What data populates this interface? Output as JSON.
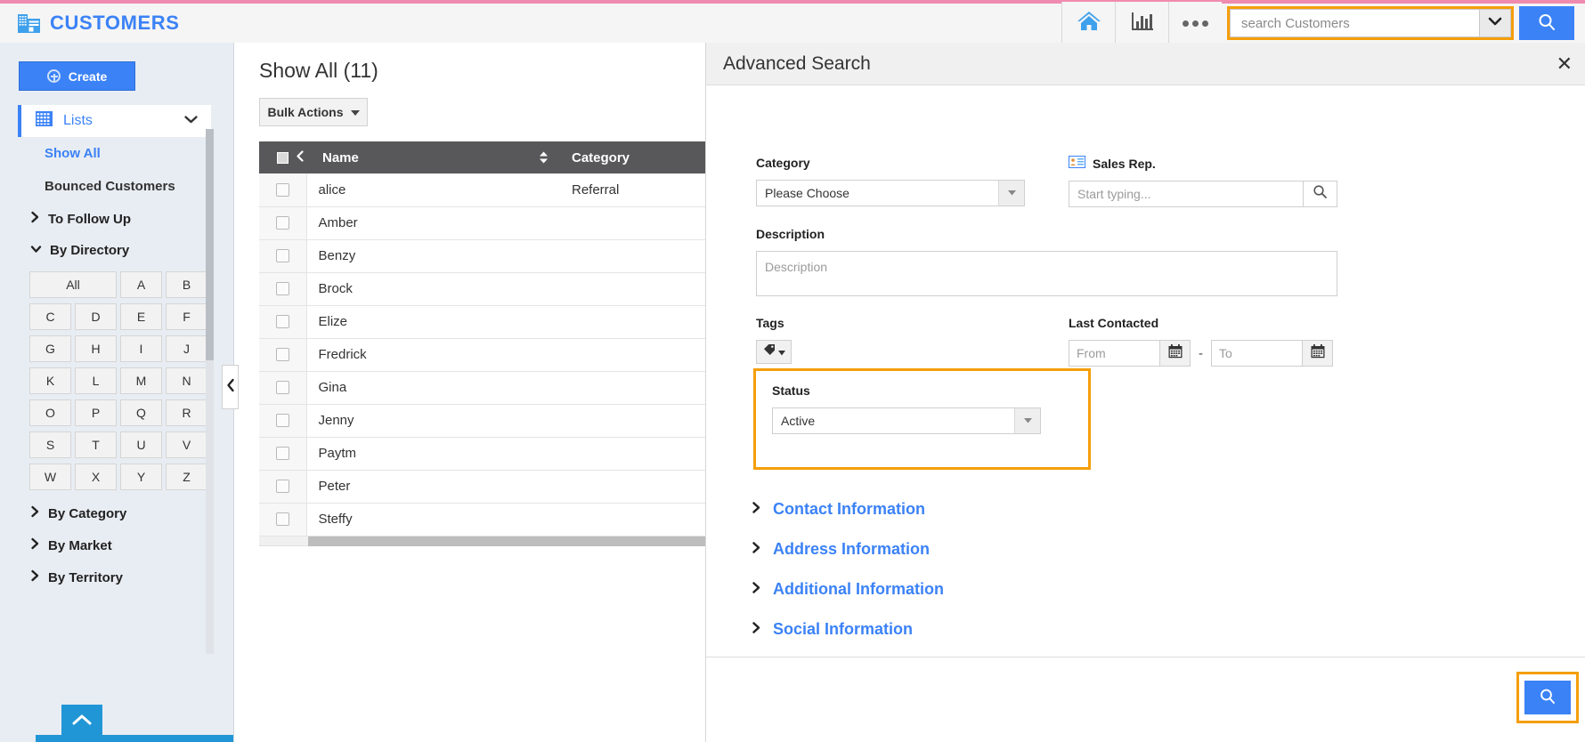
{
  "header": {
    "brand_title": "CUSTOMERS",
    "brand_icon": "building-icon",
    "home_icon": "home-icon",
    "reports_icon": "bar-chart-icon",
    "more_icon": "three-dots-icon",
    "search_placeholder": "search Customers",
    "search_value": "",
    "search_caret_icon": "chevron-down-icon",
    "search_button_icon": "search-icon",
    "accent_pink": "#f08bb0",
    "accent_blue": "#3b82f6",
    "highlight_orange": "#f59e0b"
  },
  "sidebar": {
    "create_label": "Create",
    "create_icon": "plus-circle-icon",
    "lists_label": "Lists",
    "lists_icon": "grid-icon",
    "lists_chevron": "chevron-down-icon",
    "items": [
      {
        "label": "Show All",
        "state": "active"
      },
      {
        "label": "Bounced Customers",
        "state": "normal"
      }
    ],
    "groups": [
      {
        "label": "To Follow Up",
        "expanded": false,
        "icon": "chevron-right-icon"
      },
      {
        "label": "By Directory",
        "expanded": true,
        "icon": "chevron-down-icon"
      }
    ],
    "directory_letters": [
      "All",
      "A",
      "B",
      "C",
      "D",
      "E",
      "F",
      "G",
      "H",
      "I",
      "J",
      "K",
      "L",
      "M",
      "N",
      "O",
      "P",
      "Q",
      "R",
      "S",
      "T",
      "U",
      "V",
      "W",
      "X",
      "Y",
      "Z"
    ],
    "groups_after": [
      {
        "label": "By Category",
        "expanded": false,
        "icon": "chevron-right-icon"
      },
      {
        "label": "By Market",
        "expanded": false,
        "icon": "chevron-right-icon"
      },
      {
        "label": "By Territory",
        "expanded": false,
        "icon": "chevron-right-icon"
      }
    ],
    "scroll_top_icon": "chevron-up-icon"
  },
  "list_panel": {
    "title": "Show All (11)",
    "bulk_actions_label": "Bulk Actions",
    "bulk_actions_caret": "caret-down-icon",
    "header_collapse_icon": "chevron-left-icon",
    "sort_icon": "sort-updown-icon",
    "columns": [
      "Name",
      "Category"
    ],
    "rows": [
      {
        "name": "alice",
        "category": "Referral"
      },
      {
        "name": "Amber",
        "category": ""
      },
      {
        "name": "Benzy",
        "category": ""
      },
      {
        "name": "Brock",
        "category": ""
      },
      {
        "name": "Elize",
        "category": ""
      },
      {
        "name": "Fredrick",
        "category": ""
      },
      {
        "name": "Gina",
        "category": ""
      },
      {
        "name": "Jenny",
        "category": ""
      },
      {
        "name": "Paytm",
        "category": ""
      },
      {
        "name": "Peter",
        "category": ""
      },
      {
        "name": "Steffy",
        "category": ""
      }
    ],
    "collapse_tab_icon": "chevron-left-icon"
  },
  "advanced_search": {
    "title": "Advanced Search",
    "close_icon": "close-icon",
    "category": {
      "label": "Category",
      "value": "Please Choose",
      "caret_icon": "caret-down-icon"
    },
    "sales_rep": {
      "label": "Sales Rep.",
      "icon": "contact-card-icon",
      "placeholder": "Start typing...",
      "value": "",
      "button_icon": "search-icon"
    },
    "description": {
      "label": "Description",
      "placeholder": "Description",
      "value": ""
    },
    "tags": {
      "label": "Tags",
      "button_icon": "tag-icon",
      "caret_icon": "caret-down-icon"
    },
    "last_contacted": {
      "label": "Last Contacted",
      "from_placeholder": "From",
      "from_value": "",
      "to_placeholder": "To",
      "to_value": "",
      "separator": "-",
      "calendar_icon": "calendar-icon"
    },
    "status": {
      "label": "Status",
      "value": "Active",
      "caret_icon": "caret-down-icon",
      "highlight_color": "#f59e0b"
    },
    "sections": [
      {
        "label": "Contact Information",
        "icon": "chevron-right-icon"
      },
      {
        "label": "Address Information",
        "icon": "chevron-right-icon"
      },
      {
        "label": "Additional Information",
        "icon": "chevron-right-icon"
      },
      {
        "label": "Social Information",
        "icon": "chevron-right-icon"
      }
    ],
    "footer": {
      "search_button_icon": "search-icon",
      "highlight_color": "#f59e0b"
    }
  }
}
